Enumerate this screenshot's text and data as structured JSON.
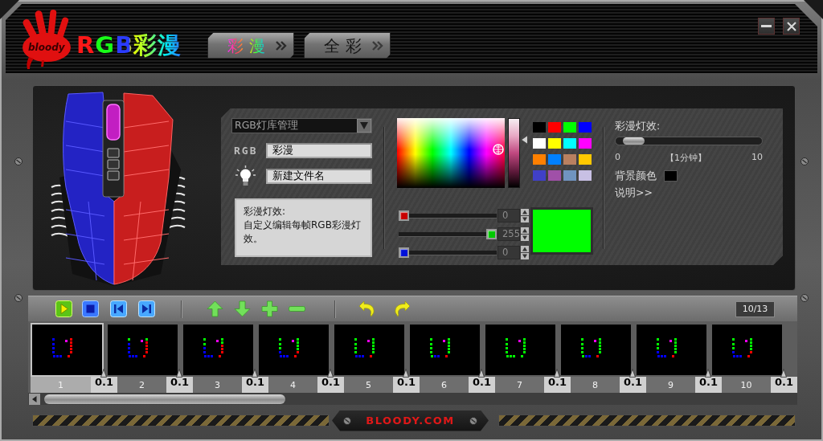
{
  "header": {
    "logo_text": "bloody",
    "title": "RGB彩漫",
    "tabs": [
      {
        "label": "彩 漫",
        "selected": true
      },
      {
        "label": "全 彩",
        "selected": false
      }
    ]
  },
  "library": {
    "dropdown": "RGB灯库管理",
    "rgb_label": "RGB",
    "name_field": "彩漫",
    "file_field": "新建文件名",
    "description": {
      "title": "彩漫灯效:",
      "text": "自定义编辑每帧RGB彩漫灯效。"
    }
  },
  "color_picker": {
    "brightness": {
      "level": 0.69
    },
    "swatches": [
      {
        "color": "#000000"
      },
      {
        "color": "#ff0000"
      },
      {
        "color": "#00ff00"
      },
      {
        "color": "#0000ff"
      },
      {
        "color": "#ffffff"
      },
      {
        "color": "#ffff00"
      },
      {
        "color": "#00ffff"
      },
      {
        "color": "#ff00ff"
      },
      {
        "color": "#ff8000"
      },
      {
        "color": "#0080ff"
      },
      {
        "color": "#b98060"
      },
      {
        "color": "#ffc800"
      },
      {
        "color": "#4040c8"
      },
      {
        "color": "#a050a8"
      },
      {
        "color": "#7094c0"
      },
      {
        "color": "#c8c0e4"
      }
    ],
    "channels": [
      {
        "kind": "red",
        "level": 0,
        "value": "0"
      },
      {
        "kind": "green",
        "level": 1,
        "value": "255"
      },
      {
        "kind": "blue",
        "level": 0,
        "value": "0"
      }
    ]
  },
  "effect": {
    "label": "彩漫灯效:",
    "speed": {
      "level": 0.06,
      "min": "0",
      "current": "【1分钟】",
      "max": "10"
    },
    "background": {
      "label": "背景颜色",
      "color": "#000000"
    },
    "help_link": "说明>>"
  },
  "toolbar": {
    "counter": "10/13"
  },
  "frames": [
    {
      "number": "1",
      "selected": true,
      "delay": "0.1",
      "leds": [
        {
          "color": "#0000ff"
        },
        {
          "color": "#0000ff"
        },
        {
          "color": "#0000ff"
        },
        {
          "color": "#0000ff"
        },
        {
          "color": "#0000ff"
        },
        {
          "color": "#0000ff"
        },
        {
          "color": "#0000ff"
        },
        {
          "color": "#ff00ff"
        },
        {
          "color": "#ff0000"
        },
        {
          "color": "#ff0000"
        },
        {
          "color": "#ff0000"
        },
        {
          "color": "#ff0000"
        },
        {
          "color": "#ff0000"
        },
        {
          "color": "#ff0000"
        }
      ]
    },
    {
      "number": "2",
      "selected": false,
      "delay": "0.1",
      "leds": [
        {
          "color": "#00ff00"
        },
        {
          "color": "#0000ff"
        },
        {
          "color": "#0000ff"
        },
        {
          "color": "#0000ff"
        },
        {
          "color": "#0000ff"
        },
        {
          "color": "#0000ff"
        },
        {
          "color": "#0000ff"
        },
        {
          "color": "#ff00ff"
        },
        {
          "color": "#00ff00"
        },
        {
          "color": "#ff0000"
        },
        {
          "color": "#ff0000"
        },
        {
          "color": "#ff0000"
        },
        {
          "color": "#ff0000"
        },
        {
          "color": "#ff0000"
        }
      ]
    },
    {
      "number": "3",
      "selected": false,
      "delay": "0.1",
      "leds": [
        {
          "color": "#00ff00"
        },
        {
          "color": "#00ff00"
        },
        {
          "color": "#0000ff"
        },
        {
          "color": "#0000ff"
        },
        {
          "color": "#0000ff"
        },
        {
          "color": "#0000ff"
        },
        {
          "color": "#0000ff"
        },
        {
          "color": "#ff00ff"
        },
        {
          "color": "#00ff00"
        },
        {
          "color": "#00ff00"
        },
        {
          "color": "#ff0000"
        },
        {
          "color": "#ff0000"
        },
        {
          "color": "#ff0000"
        },
        {
          "color": "#ff0000"
        }
      ]
    },
    {
      "number": "4",
      "selected": false,
      "delay": "0.1",
      "leds": [
        {
          "color": "#00ff00"
        },
        {
          "color": "#00ff00"
        },
        {
          "color": "#00ff00"
        },
        {
          "color": "#0000ff"
        },
        {
          "color": "#0000ff"
        },
        {
          "color": "#0000ff"
        },
        {
          "color": "#0000ff"
        },
        {
          "color": "#ff00ff"
        },
        {
          "color": "#00ff00"
        },
        {
          "color": "#00ff00"
        },
        {
          "color": "#00ff00"
        },
        {
          "color": "#00ff00"
        },
        {
          "color": "#ff0000"
        },
        {
          "color": "#ff0000"
        }
      ]
    },
    {
      "number": "5",
      "selected": false,
      "delay": "0.1",
      "leds": [
        {
          "color": "#00ff00"
        },
        {
          "color": "#00ff00"
        },
        {
          "color": "#00ff00"
        },
        {
          "color": "#00ff00"
        },
        {
          "color": "#0000ff"
        },
        {
          "color": "#0000ff"
        },
        {
          "color": "#0000ff"
        },
        {
          "color": "#ff00ff"
        },
        {
          "color": "#00ff00"
        },
        {
          "color": "#00ff00"
        },
        {
          "color": "#00ff00"
        },
        {
          "color": "#00ff00"
        },
        {
          "color": "#00ff00"
        },
        {
          "color": "#ff0000"
        }
      ]
    },
    {
      "number": "6",
      "selected": false,
      "delay": "0.1",
      "leds": [
        {
          "color": "#00ff00"
        },
        {
          "color": "#00ff00"
        },
        {
          "color": "#00ff00"
        },
        {
          "color": "#00ff00"
        },
        {
          "color": "#00ff00"
        },
        {
          "color": "#0000ff"
        },
        {
          "color": "#0000ff"
        },
        {
          "color": "#ff00ff"
        },
        {
          "color": "#00ff00"
        },
        {
          "color": "#00ff00"
        },
        {
          "color": "#00ff00"
        },
        {
          "color": "#00ff00"
        },
        {
          "color": "#00ff00"
        },
        {
          "color": "#ff0000"
        }
      ]
    },
    {
      "number": "7",
      "selected": false,
      "delay": "0.1",
      "leds": [
        {
          "color": "#00ff00"
        },
        {
          "color": "#00ff00"
        },
        {
          "color": "#00ff00"
        },
        {
          "color": "#00ff00"
        },
        {
          "color": "#00ff00"
        },
        {
          "color": "#00ff00"
        },
        {
          "color": "#00ff00"
        },
        {
          "color": "#ff00ff"
        },
        {
          "color": "#00ff00"
        },
        {
          "color": "#00ff00"
        },
        {
          "color": "#00ff00"
        },
        {
          "color": "#00ff00"
        },
        {
          "color": "#00ff00"
        },
        {
          "color": "#00ff00"
        }
      ]
    },
    {
      "number": "8",
      "selected": false,
      "delay": "0.1",
      "leds": [
        {
          "color": "#00ff00"
        },
        {
          "color": "#00ff00"
        },
        {
          "color": "#00ff00"
        },
        {
          "color": "#00ff00"
        },
        {
          "color": "#00ff00"
        },
        {
          "color": "#0000ff"
        },
        {
          "color": "#0000ff"
        },
        {
          "color": "#ff00ff"
        },
        {
          "color": "#00ff00"
        },
        {
          "color": "#00ff00"
        },
        {
          "color": "#00ff00"
        },
        {
          "color": "#00ff00"
        },
        {
          "color": "#00ff00"
        },
        {
          "color": "#ff0000"
        }
      ]
    },
    {
      "number": "9",
      "selected": false,
      "delay": "0.1",
      "leds": [
        {
          "color": "#00ff00"
        },
        {
          "color": "#00ff00"
        },
        {
          "color": "#00ff00"
        },
        {
          "color": "#0000ff"
        },
        {
          "color": "#0000ff"
        },
        {
          "color": "#0000ff"
        },
        {
          "color": "#0000ff"
        },
        {
          "color": "#ff00ff"
        },
        {
          "color": "#00ff00"
        },
        {
          "color": "#00ff00"
        },
        {
          "color": "#00ff00"
        },
        {
          "color": "#00ff00"
        },
        {
          "color": "#00ff00"
        },
        {
          "color": "#ff0000"
        }
      ]
    },
    {
      "number": "10",
      "selected": false,
      "delay": "0.1",
      "leds": [
        {
          "color": "#00ff00"
        },
        {
          "color": "#00ff00"
        },
        {
          "color": "#00ff00"
        },
        {
          "color": "#0000ff"
        },
        {
          "color": "#0000ff"
        },
        {
          "color": "#0000ff"
        },
        {
          "color": "#0000ff"
        },
        {
          "color": "#ff00ff"
        },
        {
          "color": "#00ff00"
        },
        {
          "color": "#00ff00"
        },
        {
          "color": "#00ff00"
        },
        {
          "color": "#00ff00"
        },
        {
          "color": "#ff0000"
        },
        {
          "color": "#ff0000"
        }
      ]
    }
  ],
  "footer": {
    "site": "BLOODY.COM"
  }
}
